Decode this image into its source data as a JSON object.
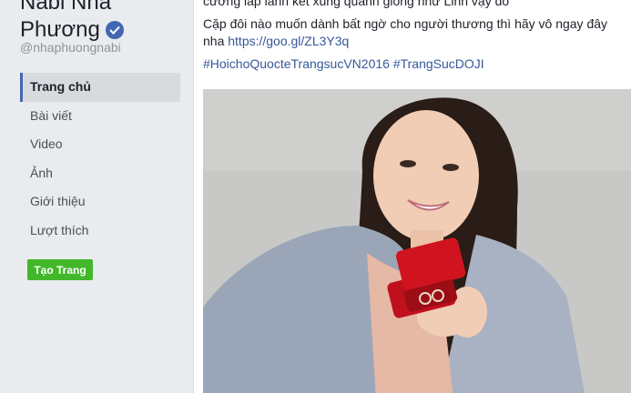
{
  "page": {
    "name_line1": "Nabi Nhã",
    "name_line2": "Phương",
    "username": "@nhaphuongnabi"
  },
  "nav": {
    "items": [
      {
        "label": "Trang chủ",
        "active": true
      },
      {
        "label": "Bài viết",
        "active": false
      },
      {
        "label": "Video",
        "active": false
      },
      {
        "label": "Ảnh",
        "active": false
      },
      {
        "label": "Giới thiệu",
        "active": false
      },
      {
        "label": "Lượt thích",
        "active": false
      }
    ]
  },
  "create_page_label": "Tạo Trang",
  "post": {
    "line1": "cương lấp lánh kết xung quanh giống như Linh vậy đó",
    "line2": "Cặp đôi nào muốn dành bất ngờ cho người thương thì hãy vô ngay đây nha",
    "link": "https://goo.gl/ZL3Y3q",
    "hashtags": "#HoichoQuocteTrangsucVN2016 #TrangSucDOJI"
  },
  "colors": {
    "accent": "#4267b2",
    "link": "#365899",
    "button_green": "#42b72a",
    "background": "#e9ebee"
  },
  "icons": {
    "verified": "verified-badge-icon"
  }
}
